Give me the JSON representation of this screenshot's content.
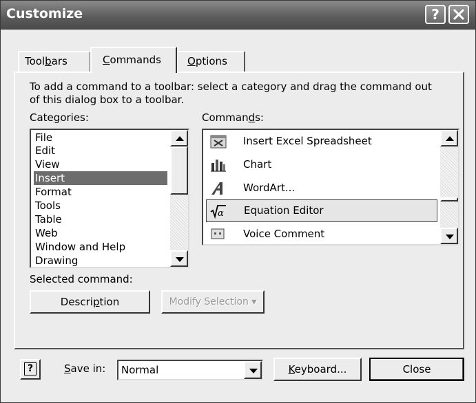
{
  "window": {
    "title": "Customize",
    "help_button": "?"
  },
  "tabs": [
    {
      "label": "Toolbars",
      "pre": "Tool",
      "mnemonic": "b",
      "post": "ars"
    },
    {
      "label": "Commands",
      "pre": "",
      "mnemonic": "C",
      "post": "ommands"
    },
    {
      "label": "Options",
      "pre": "",
      "mnemonic": "O",
      "post": "ptions"
    }
  ],
  "instructions": "To add a command to a toolbar: select a category and drag the command out of this dialog box to a toolbar.",
  "categories": {
    "label_pre": "Cate",
    "label_mnemonic": "g",
    "label_post": "ories:",
    "items": [
      "File",
      "Edit",
      "View",
      "Insert",
      "Format",
      "Tools",
      "Table",
      "Web",
      "Window and Help",
      "Drawing"
    ],
    "selected": "Insert"
  },
  "commands": {
    "label_pre": "Comman",
    "label_mnemonic": "d",
    "label_post": "s:",
    "items": [
      {
        "label": "Insert Excel Spreadsheet",
        "icon": "excel-spreadsheet-icon"
      },
      {
        "label": "Chart",
        "icon": "chart-icon"
      },
      {
        "label": "WordArt...",
        "icon": "wordart-icon"
      },
      {
        "label": "Equation Editor",
        "icon": "equation-editor-icon"
      },
      {
        "label": "Voice Comment",
        "icon": "voice-comment-icon"
      }
    ],
    "selected": "Equation Editor"
  },
  "selected_command": {
    "label": "Selected command:",
    "description_pre": "Descri",
    "description_mnemonic": "p",
    "description_post": "tion",
    "modify_label": "Modify Selection"
  },
  "footer": {
    "save_in_mnemonic": "S",
    "save_in_post": "ave in:",
    "save_in_value": "Normal",
    "keyboard_mnemonic": "K",
    "keyboard_post": "eyboard...",
    "close_label": "Close",
    "help_glyph": "?"
  }
}
